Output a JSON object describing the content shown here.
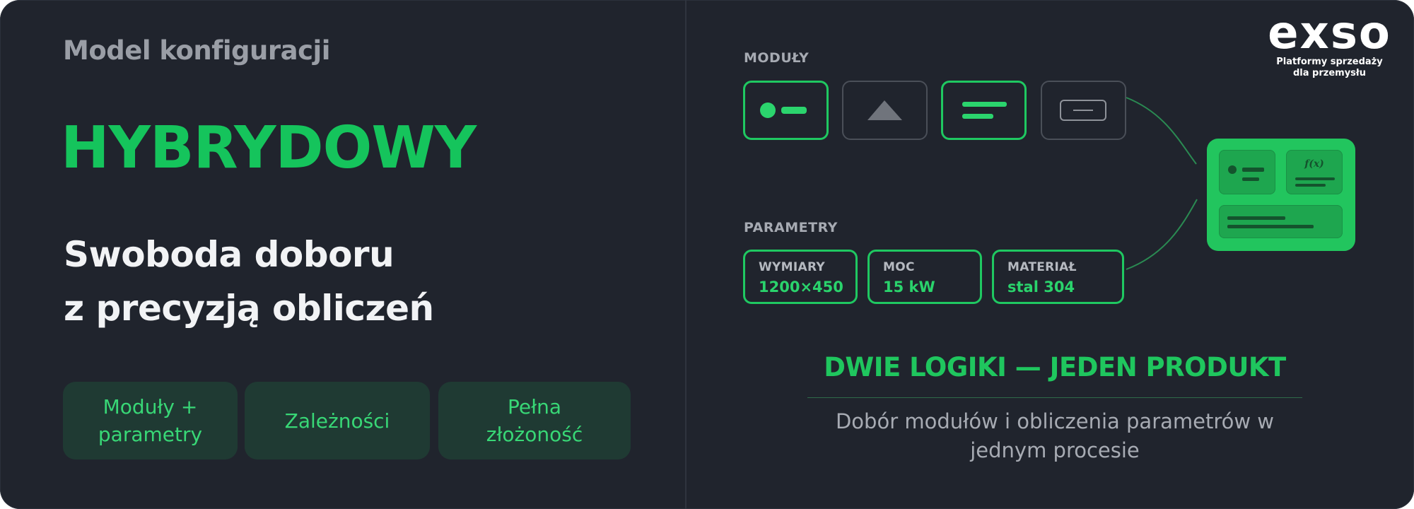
{
  "left": {
    "eyebrow": "Model konfiguracji",
    "headline": "HYBRYDOWY",
    "tagline": [
      "Swoboda doboru",
      "z precyzją obliczeń"
    ],
    "chips": [
      {
        "lines": [
          "Moduły +",
          "parametry"
        ]
      },
      {
        "lines": [
          "Zależności"
        ]
      },
      {
        "lines": [
          "Pełna",
          "złożoność"
        ]
      }
    ]
  },
  "right": {
    "modules_label": "MODUŁY",
    "modules": [
      {
        "icon": "dot-bar-icon",
        "state": "active"
      },
      {
        "icon": "triangle-icon",
        "state": "idle"
      },
      {
        "icon": "lines-icon",
        "state": "active"
      },
      {
        "icon": "input-field-icon",
        "state": "idle"
      }
    ],
    "params_label": "PARAMETRY",
    "params": [
      {
        "label": "WYMIARY",
        "value": "1200×450"
      },
      {
        "label": "MOC",
        "value": "15 kW"
      },
      {
        "label": "MATERIAŁ",
        "value": "stal 304"
      }
    ],
    "result_formula": "f(x)",
    "footer_title": "DWIE LOGIKI — JEDEN PRODUKT",
    "footer_desc": [
      "Dobór modułów i obliczenia parametrów w",
      "jednym procesie"
    ]
  },
  "logo": {
    "word": "exso",
    "sub": [
      "Platformy sprzedaży",
      "dla przemysłu"
    ]
  },
  "colors": {
    "background": "#20242d",
    "accent": "#15c45c",
    "chip_bg": "#1f3a33",
    "muted_text": "#9a9ea6"
  }
}
